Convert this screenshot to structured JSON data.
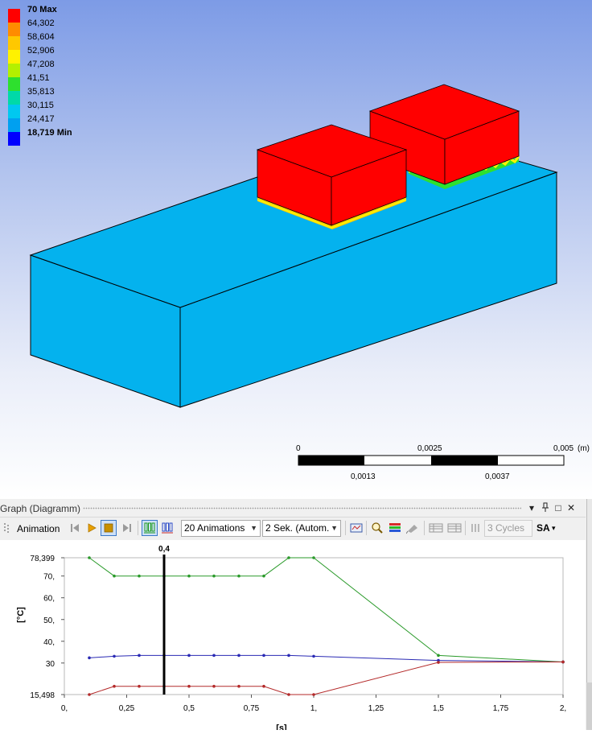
{
  "legend": {
    "entries": [
      {
        "label": "70 Max",
        "color": "#ff0000",
        "bold": true
      },
      {
        "label": "64,302",
        "color": "#ff8c00",
        "bold": false
      },
      {
        "label": "58,604",
        "color": "#ffc800",
        "bold": false
      },
      {
        "label": "52,906",
        "color": "#fff200",
        "bold": false
      },
      {
        "label": "47,208",
        "color": "#b4f000",
        "bold": false
      },
      {
        "label": "41,51",
        "color": "#2ee02e",
        "bold": false
      },
      {
        "label": "35,813",
        "color": "#00d9a8",
        "bold": false
      },
      {
        "label": "30,115",
        "color": "#00c8f0",
        "bold": false
      },
      {
        "label": "24,417",
        "color": "#00a0f0",
        "bold": false
      },
      {
        "label": "18,719 Min",
        "color": "#0000ff",
        "bold": true
      }
    ]
  },
  "scale": {
    "unit": "(m)",
    "top_ticks": [
      "0",
      "0,0025",
      "0,005"
    ],
    "bottom_ticks": [
      "0,0013",
      "0,0037"
    ]
  },
  "panel": {
    "title": "Graph (Diagramm)",
    "pin": "▾",
    "dock": "🖈",
    "maximize": "□",
    "close": "✕"
  },
  "toolbar": {
    "animation_label": "Animation",
    "frames_select": "20 Animations",
    "duration_select": "2 Sek. (Autom.",
    "cycles_select": "3 Cycles",
    "sa_label": "SA"
  },
  "chart_data": {
    "type": "line",
    "title": "",
    "xlabel": "[s]",
    "ylabel": "[°C]",
    "xlim": [
      0,
      2
    ],
    "ylim": [
      15.498,
      78.399
    ],
    "x_ticks": [
      "0,",
      "0,25",
      "0,5",
      "0,75",
      "1,",
      "1,25",
      "1,5",
      "1,75",
      "2,"
    ],
    "y_ticks": [
      "15,498",
      "30",
      "40,",
      "50,",
      "60,",
      "70,",
      "78,399"
    ],
    "marker": {
      "x": 0.4,
      "label": "0,4"
    },
    "series": [
      {
        "color": "#2a9a2a",
        "x": [
          0.1,
          0.2,
          0.3,
          0.4,
          0.5,
          0.6,
          0.7,
          0.8,
          0.9,
          1.0,
          1.5,
          2.0
        ],
        "values": [
          78.399,
          70,
          70,
          70,
          70,
          70,
          70,
          70,
          78.399,
          78.399,
          33.5,
          30.5
        ]
      },
      {
        "color": "#2a2ab4",
        "x": [
          0.1,
          0.2,
          0.3,
          0.4,
          0.5,
          0.6,
          0.7,
          0.8,
          0.9,
          1.0,
          1.5,
          2.0
        ],
        "values": [
          32.4,
          33.1,
          33.5,
          33.5,
          33.5,
          33.5,
          33.5,
          33.5,
          33.5,
          33.1,
          31.2,
          30.5
        ]
      },
      {
        "color": "#b42a2a",
        "x": [
          0.1,
          0.2,
          0.3,
          0.4,
          0.5,
          0.6,
          0.7,
          0.8,
          0.9,
          1.0,
          1.5,
          2.0
        ],
        "values": [
          15.498,
          19.3,
          19.3,
          19.3,
          19.3,
          19.3,
          19.3,
          19.3,
          15.498,
          15.498,
          30.3,
          30.5
        ]
      }
    ]
  }
}
